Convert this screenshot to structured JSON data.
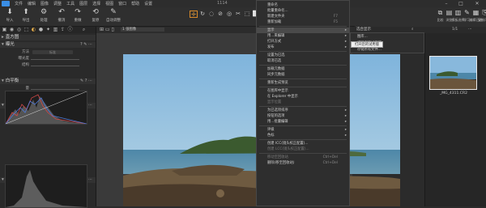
{
  "window": {
    "title": "1114",
    "controls": [
      "–",
      "□",
      "✕"
    ]
  },
  "menubar": {
    "items": [
      "文件",
      "编辑",
      "图像",
      "调整",
      "工具",
      "图层",
      "选择",
      "视图",
      "窗口",
      "帮助",
      "设置"
    ]
  },
  "toolbar": {
    "buttons": [
      {
        "icon": "import-icon",
        "glyph": "⬇",
        "label": "导入"
      },
      {
        "icon": "export-icon",
        "glyph": "⬆",
        "label": "导出"
      },
      {
        "icon": "process-icon",
        "glyph": "⚙",
        "label": "处理"
      },
      {
        "icon": "undo-icon",
        "glyph": "↶",
        "label": "撤消"
      },
      {
        "icon": "redo-icon",
        "glyph": "↷",
        "label": "重做"
      },
      {
        "icon": "reset-icon",
        "glyph": "⟲",
        "label": "复原"
      },
      {
        "icon": "auto-adjust-icon",
        "glyph": "✎",
        "label": "自动调整"
      }
    ],
    "tools": [
      "✛",
      "↻",
      "◌",
      "⊘",
      "◎",
      "✂",
      "⬚",
      "⬜",
      "◈"
    ],
    "right_buttons": [
      {
        "icon": "compare-icon",
        "glyph": "⧉",
        "label": "比较"
      },
      {
        "icon": "browse-icon",
        "glyph": "▤",
        "label": "浏览"
      },
      {
        "icon": "panel-icon",
        "glyph": "▥",
        "label": "模板选择"
      },
      {
        "icon": "learn-icon",
        "glyph": "✎",
        "label": "学习"
      },
      {
        "icon": "edit-icon",
        "glyph": "▦",
        "label": "编辑已选"
      },
      {
        "icon": "copy-paste-icon",
        "glyph": "⎘",
        "label": "复制/粘贴"
      }
    ]
  },
  "left_panel": {
    "sections": {
      "histogram": "直方图",
      "lens": "曝光",
      "wb": "白平衡",
      "color": "色阶",
      "color2": "色阶"
    },
    "rows": {
      "method": "方法",
      "method_val": "标准",
      "contrast": "曝光度",
      "struct": "结构",
      "amount": "量",
      "noise": "噪色",
      "white_balance": "白色平衡"
    },
    "subtabs": [
      "RGB",
      "亮度",
      "红色",
      "绿色",
      "蓝色"
    ],
    "subtabs_active": 1
  },
  "center": {
    "zoom": "1 张图像",
    "hint": "选合"
  },
  "context_menu": {
    "items": [
      {
        "label": "重命名",
        "shortcut": "",
        "arrow": false,
        "dim": false
      },
      {
        "label": "批量重命名...",
        "shortcut": "",
        "arrow": false,
        "dim": false
      },
      {
        "label": "新建文件夹",
        "shortcut": "F7",
        "arrow": false,
        "dim": false
      },
      {
        "label": "重新加载",
        "shortcut": "F5",
        "arrow": false,
        "dim": false
      },
      {
        "sep": true
      },
      {
        "label": "显示",
        "shortcut": "",
        "arrow": true,
        "dim": false,
        "hl": true
      },
      {
        "label": "用...来编辑",
        "shortcut": "",
        "arrow": true,
        "dim": false
      },
      {
        "label": "打开方式",
        "shortcut": "",
        "arrow": true,
        "dim": false
      },
      {
        "label": "发布",
        "shortcut": "",
        "arrow": true,
        "dim": false
      },
      {
        "sep": true
      },
      {
        "label": "设置为已选",
        "shortcut": "",
        "arrow": false,
        "dim": false
      },
      {
        "label": "取消已选",
        "shortcut": "",
        "arrow": false,
        "dim": false
      },
      {
        "sep": true
      },
      {
        "label": "加载元数据",
        "shortcut": "",
        "arrow": false,
        "dim": false
      },
      {
        "label": "同步元数据",
        "shortcut": "",
        "arrow": false,
        "dim": false
      },
      {
        "sep": true
      },
      {
        "label": "重新生成预览",
        "shortcut": "",
        "arrow": false,
        "dim": false
      },
      {
        "sep": true
      },
      {
        "label": "在图库中显示",
        "shortcut": "",
        "arrow": false,
        "dim": false
      },
      {
        "label": "在 Explorer 中显示",
        "shortcut": "",
        "arrow": false,
        "dim": false
      },
      {
        "label": "显示位置",
        "shortcut": "",
        "arrow": false,
        "dim": true
      },
      {
        "sep": true
      },
      {
        "label": "为已选项排序",
        "shortcut": "",
        "arrow": true,
        "dim": false
      },
      {
        "label": "按钮的选项",
        "shortcut": "",
        "arrow": true,
        "dim": false
      },
      {
        "label": "用...批量编辑",
        "shortcut": "",
        "arrow": true,
        "dim": false
      },
      {
        "sep": true
      },
      {
        "label": "评级",
        "shortcut": "",
        "arrow": true,
        "dim": false
      },
      {
        "label": "色标",
        "shortcut": "",
        "arrow": true,
        "dim": false
      },
      {
        "sep": true
      },
      {
        "label": "创建 ICC(镜头校正配置)...",
        "shortcut": "",
        "arrow": false,
        "dim": false
      },
      {
        "label": "创建 LCC(镜头校正配置)...",
        "shortcut": "",
        "arrow": false,
        "dim": true
      },
      {
        "sep": true
      },
      {
        "label": "移动至回收站",
        "shortcut": "Ctrl+Del",
        "arrow": false,
        "dim": true
      },
      {
        "label": "删除(移至回收站)",
        "shortcut": "Ctrl+Del",
        "arrow": false,
        "dim": false
      }
    ]
  },
  "submenu": {
    "items": [
      "图库...",
      "打开您的试用版",
      "存储所有文件..."
    ]
  },
  "tooltip": "打开您的试用版",
  "browser": {
    "label": "选合显示",
    "page": "1/1"
  },
  "filmstrip": {
    "caption": "_MG_4311.CR2"
  }
}
